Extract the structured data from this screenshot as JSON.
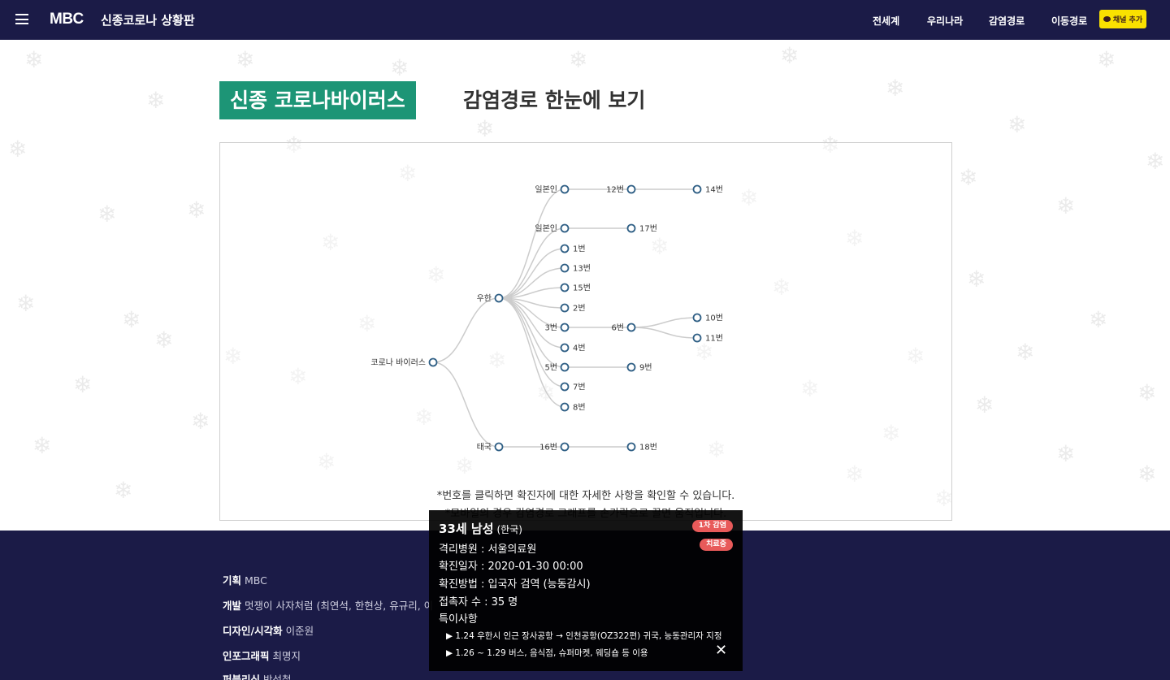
{
  "header": {
    "logo": "MBC",
    "title": "신종코로나 상황판",
    "nav": [
      "전세계",
      "우리나라",
      "감염경로",
      "이동경로"
    ],
    "kakao_label": "채널 추가"
  },
  "page": {
    "heading_highlight": "신종 코로나바이러스",
    "heading_rest": "감염경로 한눈에 보기",
    "note_click": "*번호를 클릭하면 확진자에 대한 자세한 사항을 확인할 수 있습니다.",
    "note_mobile": "*모바일의 경우 감염경로 그래프를 손가락으로 끌면 움직입니다."
  },
  "graph": {
    "root": "코로나 바이러스",
    "nodes": {
      "wuhan": "우한",
      "thai": "태국",
      "jp1": "일본인",
      "jp2": "일본인",
      "n1": "1번",
      "n2": "2번",
      "n3": "3번",
      "n4": "4번",
      "n5": "5번",
      "n6": "6번",
      "n7": "7번",
      "n8": "8번",
      "n9": "9번",
      "n10": "10번",
      "n11": "11번",
      "n12": "12번",
      "n13": "13번",
      "n14": "14번",
      "n15": "15번",
      "n16": "16번",
      "n17": "17번",
      "n18": "18번"
    }
  },
  "footer": {
    "credits": [
      {
        "role": "기획",
        "name": "MBC"
      },
      {
        "role": "개발",
        "name": "멋쟁이 사자처럼 (최연석, 한현상, 유규리, 이"
      },
      {
        "role": "디자인/시각화",
        "name": "이준원"
      },
      {
        "role": "인포그래픽",
        "name": "최명지"
      },
      {
        "role": "퍼블리싱",
        "name": "박성철"
      }
    ]
  },
  "popup": {
    "title": "33세 남성",
    "nationality": "(한국)",
    "badge_infection": "1차 감염",
    "badge_status": "치료중",
    "hospital": "격리병원 : 서울의료원",
    "confirmed_date": "확진일자 : 2020-01-30 00:00",
    "method": "확진방법 : 입국자 검역 (능동감시)",
    "contacts": "접촉자 수 : 35 명",
    "notes_label": "특이사항",
    "notes": [
      "▶ 1.24 우한시 인근 장사공항 → 인천공항(OZ322편) 귀국, 능동관리자 지정",
      "▶ 1.26 ~ 1.29 버스, 음식점, 슈퍼마켓, 웨딩숍 등 이용"
    ],
    "close": "✕"
  },
  "colors": {
    "header_bg": "#1b1b47",
    "heading_green": "#1d9576",
    "node_stroke": "#2f5f85",
    "badge_red": "#e85a5a",
    "kakao_yellow": "#fae100"
  }
}
